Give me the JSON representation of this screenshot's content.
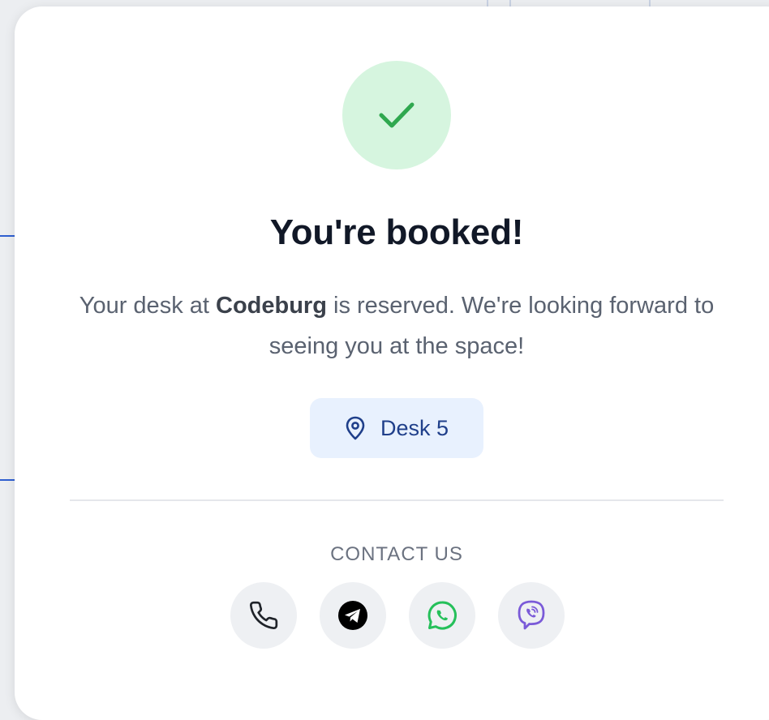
{
  "dialog": {
    "title": "You're booked!",
    "message_before": "Your desk at ",
    "location_name": "Codeburg",
    "message_after": " is reserved. We're looking forward to seeing you at the space!",
    "desk_label": "Desk 5",
    "contact_label": "CONTACT US",
    "contact_buttons": [
      {
        "icon": "phone-icon"
      },
      {
        "icon": "telegram-icon"
      },
      {
        "icon": "whatsapp-icon"
      },
      {
        "icon": "viber-icon"
      }
    ]
  },
  "colors": {
    "success_bg": "#d6f5df",
    "success_check": "#2fa84f",
    "badge_bg": "#e8f1fe",
    "badge_text": "#1f3f8a",
    "whatsapp": "#25c05a",
    "viber": "#7a5ad8"
  }
}
